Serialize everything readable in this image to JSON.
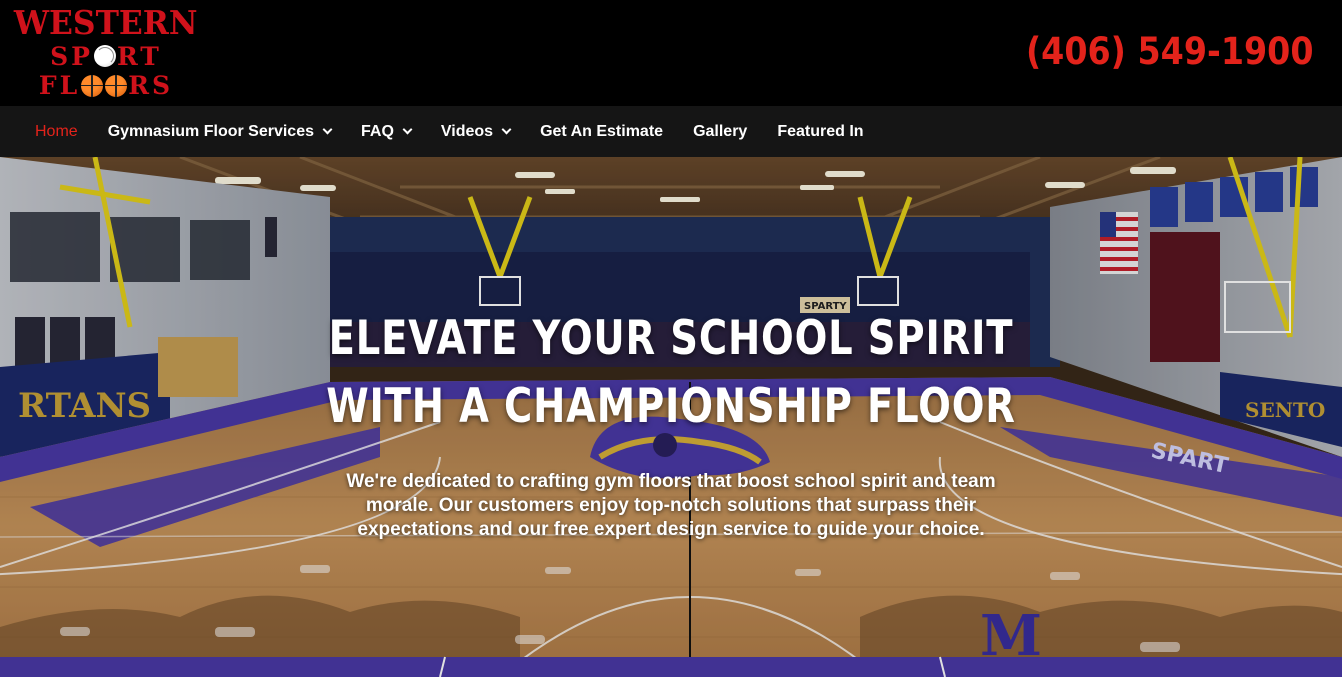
{
  "brand": {
    "logo_line1": "WESTERN",
    "logo_line2_a": "SP",
    "logo_line2_b": "RT",
    "logo_line3_a": "FL",
    "logo_line3_b": "RS",
    "logo_color": "#d0121b"
  },
  "header": {
    "phone": "(406) 549-1900",
    "phone_color": "#e3231b"
  },
  "nav": {
    "items": [
      {
        "label": "Home",
        "active": true,
        "dropdown": false
      },
      {
        "label": "Gymnasium Floor Services",
        "active": false,
        "dropdown": true
      },
      {
        "label": "FAQ",
        "active": false,
        "dropdown": true
      },
      {
        "label": "Videos",
        "active": false,
        "dropdown": true
      },
      {
        "label": "Get An Estimate",
        "active": false,
        "dropdown": false
      },
      {
        "label": "Gallery",
        "active": false,
        "dropdown": false
      },
      {
        "label": "Featured In",
        "active": false,
        "dropdown": false
      }
    ]
  },
  "hero": {
    "title": "ELEVATE YOUR SCHOOL SPIRIT WITH A CHAMPIONSHIP FLOOR",
    "subtitle": "We're dedicated to crafting gym floors that boost school spirit and team morale. Our customers enjoy top-notch solutions that surpass their expectations and our free expert design service to guide your choice.",
    "image_text": {
      "banner_left": "RTANS",
      "banner_right": "SPART",
      "sign": "SPARTY",
      "floor_letter": "M"
    },
    "accent_purple": "#4b3aa8"
  }
}
